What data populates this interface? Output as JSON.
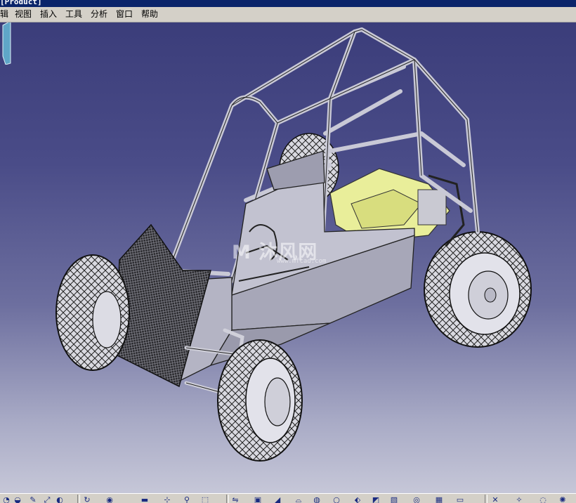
{
  "window": {
    "title": "[Product]"
  },
  "menu": {
    "items": [
      {
        "id": "edit",
        "label": "辑"
      },
      {
        "id": "view",
        "label": "视图"
      },
      {
        "id": "insert",
        "label": "插入"
      },
      {
        "id": "tools",
        "label": "工具"
      },
      {
        "id": "analyze",
        "label": "分析"
      },
      {
        "id": "window",
        "label": "窗口"
      },
      {
        "id": "help",
        "label": "帮助"
      }
    ]
  },
  "viewport": {
    "background_top": "#3b3d7a",
    "background_bottom": "#c6c7d8",
    "model": "off-road buggy assembly with roll cage, four knobby tires and yellow engine",
    "compass_color": "#5fa6c8"
  },
  "watermark": {
    "main": "M 沐风网",
    "sub": "www.mfcad.com"
  },
  "toolbar": {
    "icons": [
      "sketch-icon",
      "arc-icon",
      "constraint-icon",
      "measure-icon",
      "analysis-icon",
      "pad-icon",
      "pocket-icon",
      "shaft-icon",
      "hole-icon",
      "rib-icon",
      "pattern-icon",
      "mirror-icon",
      "fillet-icon",
      "chamfer-icon",
      "draft-icon",
      "shell-icon",
      "thickness-icon",
      "split-icon",
      "boolean-icon",
      "material-icon",
      "render-icon",
      "lighting-icon",
      "section-icon",
      "snapshot-icon"
    ]
  }
}
